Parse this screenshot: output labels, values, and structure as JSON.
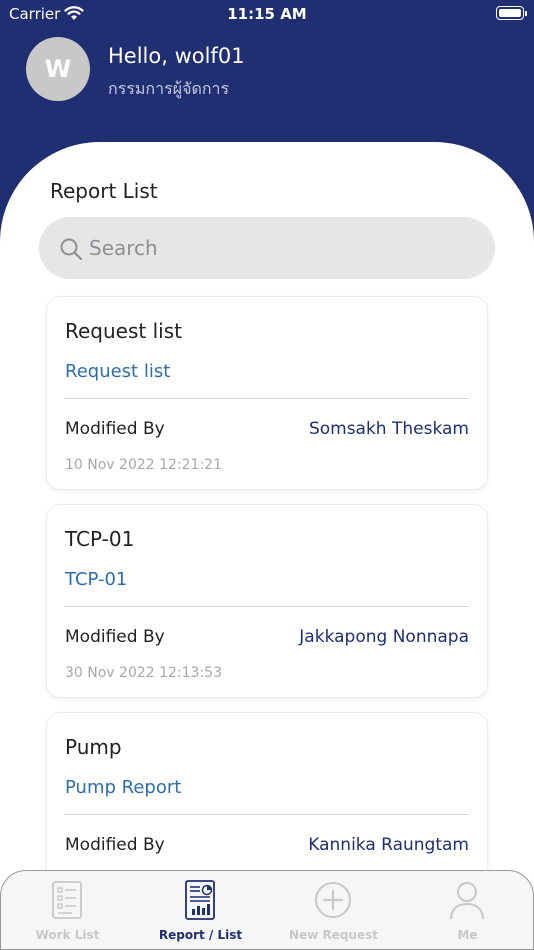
{
  "status_bar": {
    "carrier": "Carrier",
    "time": "11:15 AM"
  },
  "header": {
    "avatar_initial": "W",
    "greeting": "Hello, wolf01",
    "role": "กรรมการผู้จัดการ"
  },
  "colors": {
    "header_bg": "#1f2f72",
    "link": "#2d6db0",
    "accent": "#1f2f72",
    "inactive": "#c8c8c8"
  },
  "main": {
    "title": "Report List",
    "search": {
      "placeholder": "Search",
      "value": ""
    },
    "cards": [
      {
        "title": "Request list",
        "link": "Request list",
        "modified_label": "Modified By",
        "modified_by": "Somsakh Theskam",
        "date": "10 Nov 2022 12:21:21"
      },
      {
        "title": "TCP-01",
        "link": "TCP-01",
        "modified_label": "Modified By",
        "modified_by": "Jakkapong Nonnapa",
        "date": "30 Nov 2022 12:13:53"
      },
      {
        "title": "Pump",
        "link": "Pump Report",
        "modified_label": "Modified By",
        "modified_by": "Kannika Raungtam",
        "date": ""
      }
    ]
  },
  "tab_bar": {
    "items": [
      {
        "label": "Work List",
        "icon": "work-list-icon",
        "active": false
      },
      {
        "label": "Report / List",
        "icon": "report-list-icon",
        "active": true
      },
      {
        "label": "New Request",
        "icon": "plus-circle-icon",
        "active": false
      },
      {
        "label": "Me",
        "icon": "user-icon",
        "active": false
      }
    ]
  }
}
